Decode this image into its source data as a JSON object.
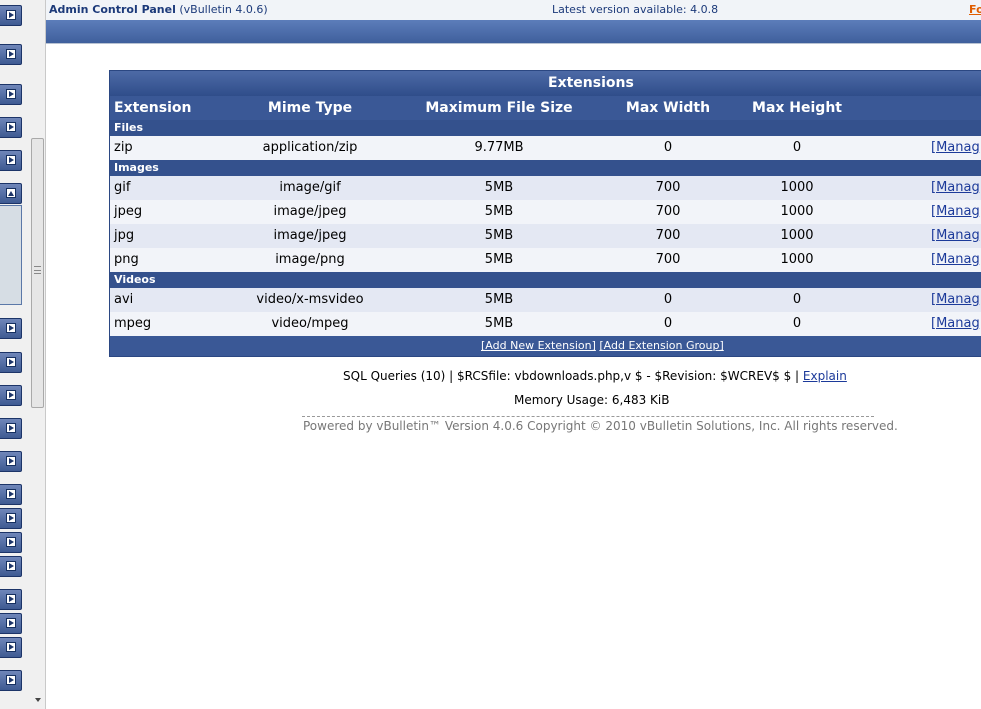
{
  "header": {
    "title": "Admin Control Panel",
    "version": "(vBulletin 4.0.6)",
    "latest": "Latest version available: 4.0.8",
    "right_link": "Fo"
  },
  "table": {
    "title": "Extensions",
    "columns": [
      "Extension",
      "Mime Type",
      "Maximum File Size",
      "Max Width",
      "Max Height"
    ],
    "groups": [
      {
        "name": "Files",
        "rows": [
          {
            "ext": "zip",
            "mime": "application/zip",
            "size": "9.77MB",
            "width": "0",
            "height": "0",
            "action": "[Manag"
          }
        ]
      },
      {
        "name": "Images",
        "rows": [
          {
            "ext": "gif",
            "mime": "image/gif",
            "size": "5MB",
            "width": "700",
            "height": "1000",
            "action": "[Manag"
          },
          {
            "ext": "jpeg",
            "mime": "image/jpeg",
            "size": "5MB",
            "width": "700",
            "height": "1000",
            "action": "[Manag"
          },
          {
            "ext": "jpg",
            "mime": "image/jpeg",
            "size": "5MB",
            "width": "700",
            "height": "1000",
            "action": "[Manag"
          },
          {
            "ext": "png",
            "mime": "image/png",
            "size": "5MB",
            "width": "700",
            "height": "1000",
            "action": "[Manag"
          }
        ]
      },
      {
        "name": "Videos",
        "rows": [
          {
            "ext": "avi",
            "mime": "video/x-msvideo",
            "size": "5MB",
            "width": "0",
            "height": "0",
            "action": "[Manag"
          },
          {
            "ext": "mpeg",
            "mime": "video/mpeg",
            "size": "5MB",
            "width": "0",
            "height": "0",
            "action": "[Manag"
          }
        ]
      }
    ],
    "add_extension": "[Add New Extension]",
    "add_group": "[Add Extension Group]"
  },
  "footer": {
    "sql": "SQL Queries (10) | $RCSfile: vbdownloads.php,v $ - $Revision: $WCREV$ $ |",
    "explain": "Explain",
    "memory": "Memory Usage: 6,483 KiB",
    "copyright": "Powered by vBulletin™ Version 4.0.6 Copyright © 2010 vBulletin Solutions, Inc. All rights reserved."
  },
  "nav": {
    "button_icons": [
      "expand-icon",
      "collapse-icon"
    ]
  }
}
